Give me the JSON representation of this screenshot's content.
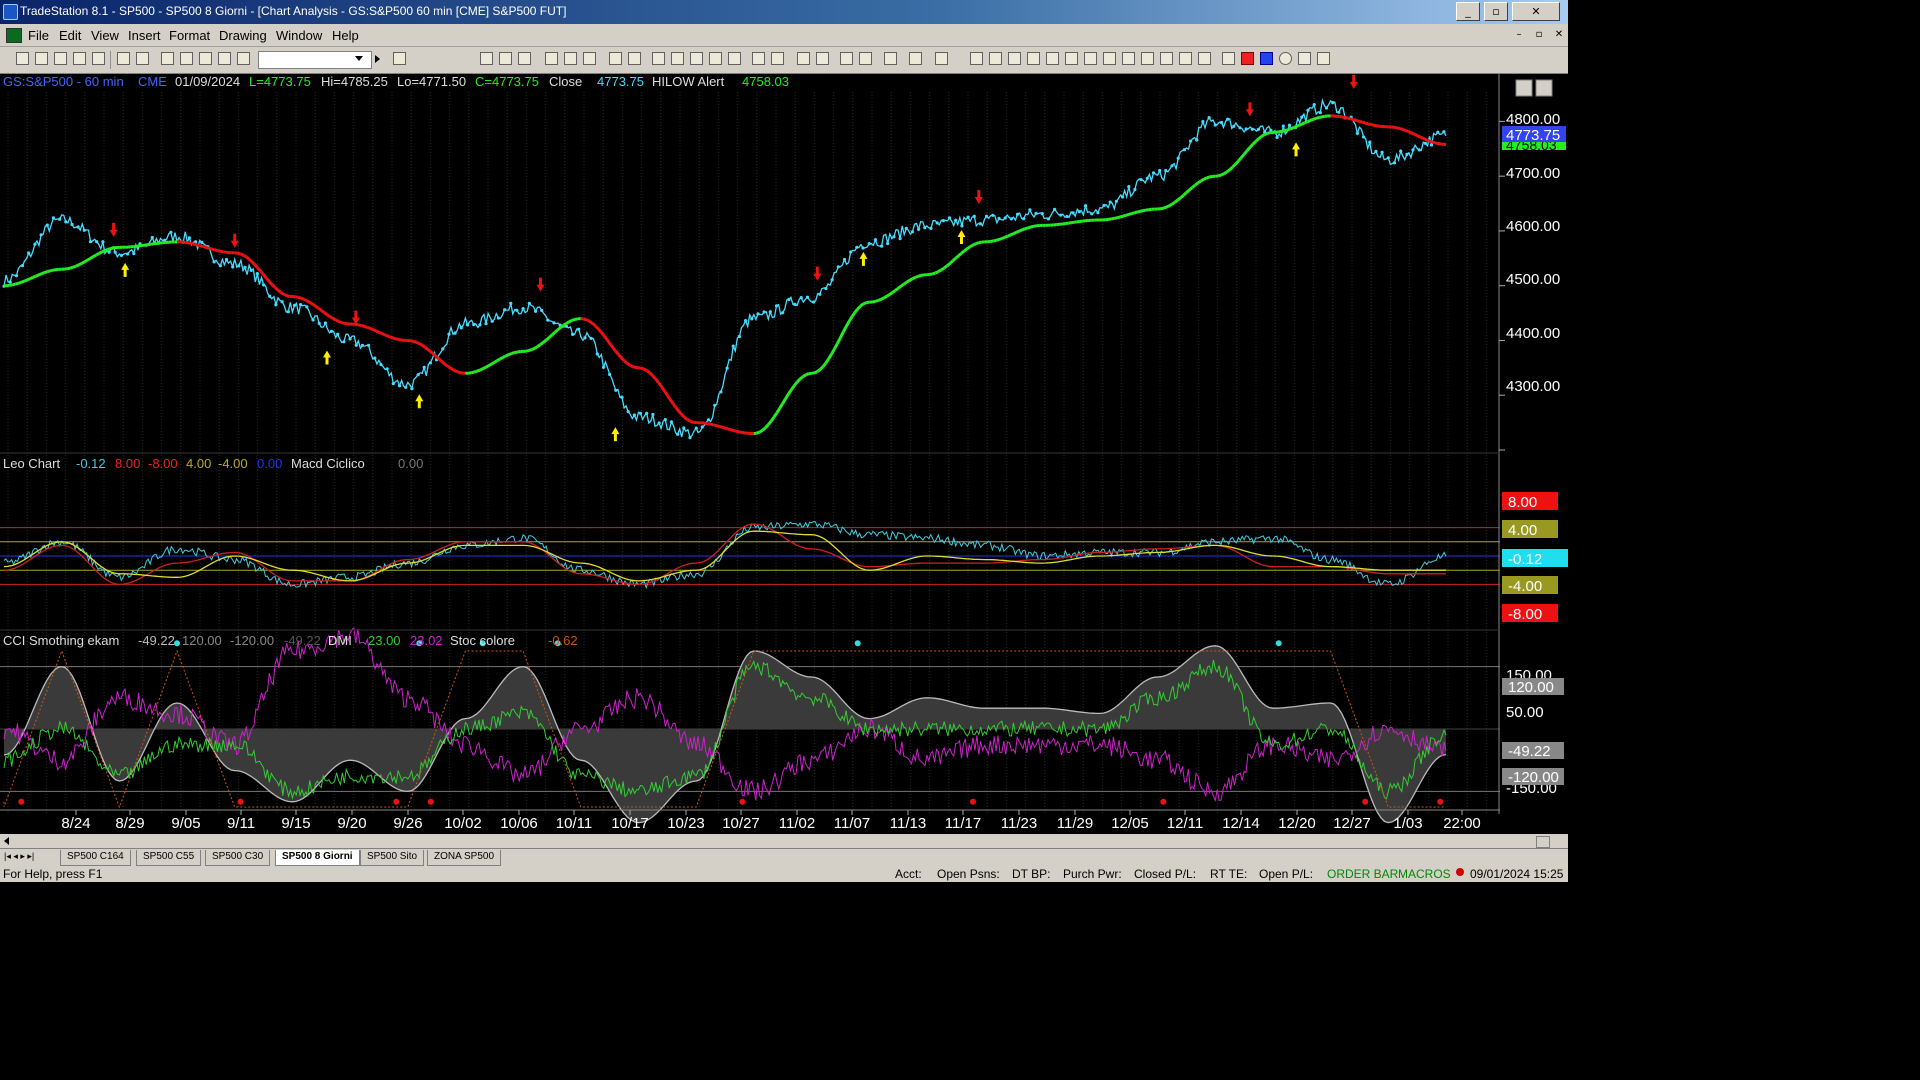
{
  "window": {
    "title": "TradeStation 8.1 - SP500 - SP500 8 Giorni - [Chart Analysis - GS:S&P500  60 min  [CME] S&P500 FUT]",
    "minimize": "_",
    "restore": "▫",
    "close": "✕"
  },
  "menu": {
    "items": [
      "File",
      "Edit",
      "View",
      "Insert",
      "Format",
      "Drawing",
      "Window",
      "Help"
    ],
    "mdi_buttons": [
      "–",
      "▫",
      "✕"
    ]
  },
  "toolbar": {
    "symbol_value": "",
    "icons": [
      "new-icon",
      "open-icon",
      "save-icon",
      "print-icon",
      "cut-icon",
      "copy-icon",
      "paste-icon",
      "zoom-in-icon",
      "zoom-out-icon",
      "cursor-icon",
      "trendline-icon",
      "text-icon"
    ]
  },
  "chart": {
    "header": {
      "symbol": "GS:S&P500 - 60 min",
      "exchange": "CME",
      "date": "01/09/2024",
      "last": "L=4773.75",
      "high": "Hi=4785.25",
      "low": "Lo=4771.50",
      "close_c": "C=4773.75",
      "close_label": "Close",
      "close_value": "4773.75",
      "indicator_name": "HILOW Alert",
      "indicator_value": "4758.03"
    },
    "price_axis": [
      "4800.00",
      "4700.00",
      "4600.00",
      "4500.00",
      "4400.00",
      "4300.00"
    ],
    "price_tag_last": "4773.75",
    "price_tag_green": "4758.03",
    "panel2": {
      "name": "Leo Chart",
      "values": [
        "-0.12",
        "8.00",
        "-8.00",
        "4.00",
        "-4.00",
        "0.00"
      ],
      "name2": "Macd Ciclico",
      "value2": "0.00",
      "axis_tags": [
        "8.00",
        "4.00",
        "-0.12",
        "-4.00",
        "-8.00"
      ]
    },
    "panel3": {
      "name": "CCI Smothing ekam",
      "values": [
        "-49.22",
        "120.00",
        "-120.00",
        "-49.22"
      ],
      "dmi_label": "DMI",
      "dmi_values": [
        "23.00",
        "23.02"
      ],
      "stoc_label": "Stoc colore",
      "stoc_value": "-0.62",
      "axis_labels": [
        "150.00",
        "50.00",
        "-150.00"
      ],
      "axis_tags": [
        "120.00",
        "-49.22",
        "-120.00"
      ]
    },
    "date_axis": [
      "8/24",
      "8/29",
      "9/05",
      "9/11",
      "9/15",
      "9/20",
      "9/26",
      "10/02",
      "10/06",
      "10/11",
      "10/17",
      "10/23",
      "10/27",
      "11/02",
      "11/07",
      "11/13",
      "11/17",
      "11/23",
      "11/29",
      "12/05",
      "12/11",
      "12/14",
      "12/20",
      "12/27",
      "1/03",
      "22:00"
    ],
    "colors": {
      "price": "#44ddff",
      "ma_up": "#22ee22",
      "ma_down": "#ee1111",
      "arrow_up": "#ffee00",
      "arrow_down": "#ee1111",
      "macd_blue": "#44ccdd",
      "macd_red": "#cc2222",
      "macd_yellow": "#dddd33",
      "cci_white": "#bbbbbb",
      "dmi_magenta": "#cc22cc",
      "dmi_green": "#33cc33",
      "stoc_orange": "#cc5511"
    }
  },
  "sheet_tabs": [
    "SP500 C164",
    "SP500 C55",
    "SP500 C30",
    "SP500 8 Giorni",
    "SP500 Sito",
    "ZONA SP500"
  ],
  "active_tab": "SP500 8 Giorni",
  "status": {
    "help": "For Help, press F1",
    "acct": "Acct:",
    "open_psns": "Open Psns:",
    "dt_bp": "DT BP:",
    "purch_pwr": "Purch Pwr:",
    "closed_pl": "Closed P/L:",
    "rt_te": "RT TE:",
    "open_pl": "Open P/L:",
    "order_bar": "ORDER BAR",
    "macros": "MACROS",
    "datetime": "09/01/2024 15:25"
  },
  "chart_data": [
    {
      "type": "line",
      "title": "GS:S&P500 - 60 min",
      "x": [
        "8/24",
        "8/29",
        "9/05",
        "9/11",
        "9/15",
        "9/20",
        "9/26",
        "10/02",
        "10/06",
        "10/11",
        "10/17",
        "10/23",
        "10/27",
        "11/02",
        "11/07",
        "11/13",
        "11/17",
        "11/23",
        "11/29",
        "12/05",
        "12/11",
        "12/14",
        "12/20",
        "12/27",
        "1/03",
        "22:00"
      ],
      "series": [
        {
          "name": "Close",
          "values": [
            4510,
            4620,
            4560,
            4590,
            4540,
            4460,
            4400,
            4320,
            4430,
            4460,
            4410,
            4260,
            4230,
            4440,
            4480,
            4580,
            4610,
            4620,
            4630,
            4640,
            4700,
            4800,
            4780,
            4830,
            4730,
            4773.75
          ]
        },
        {
          "name": "HILOW Alert",
          "values": [
            4500,
            4530,
            4570,
            4580,
            4560,
            4480,
            4430,
            4400,
            4340,
            4380,
            4440,
            4350,
            4250,
            4230,
            4340,
            4470,
            4520,
            4580,
            4610,
            4620,
            4640,
            4700,
            4780,
            4810,
            4790,
            4758.03
          ]
        }
      ],
      "ylim": [
        4200,
        4850
      ]
    },
    {
      "type": "line",
      "title": "Leo Chart",
      "x": [
        "8/24",
        "8/29",
        "9/05",
        "9/11",
        "9/15",
        "9/20",
        "9/26",
        "10/02",
        "10/06",
        "10/11",
        "10/17",
        "10/23",
        "10/27",
        "11/02",
        "11/07",
        "11/13",
        "11/17",
        "11/23",
        "11/29",
        "12/05",
        "12/11",
        "12/14",
        "12/20",
        "12/27",
        "1/03",
        "22:00"
      ],
      "series": [
        {
          "values": [
            -2,
            4,
            -6,
            2,
            -1,
            -8,
            -6,
            -2,
            3,
            5,
            -4,
            -8,
            -5,
            8,
            9,
            6,
            5,
            3,
            0,
            1,
            1,
            4,
            5,
            -1,
            -8,
            -0.12
          ]
        },
        {
          "values": [
            -4,
            3,
            -8,
            -2,
            1,
            -7,
            -7,
            -1,
            4,
            4,
            -5,
            -8,
            -2,
            9,
            2,
            -3,
            -2,
            -2,
            -1,
            1,
            2,
            3,
            -3,
            -3,
            -5,
            -5
          ]
        },
        {
          "values": [
            -3,
            4,
            -5,
            -6,
            0,
            -4,
            -7,
            -2,
            3,
            3,
            -2,
            -7,
            -4,
            7,
            6,
            -4,
            0,
            -1,
            -2,
            0,
            1,
            3,
            0,
            -3,
            -4,
            -4
          ]
        }
      ],
      "ylim": [
        -10,
        10
      ]
    },
    {
      "type": "line",
      "title": "CCI Smothing ekam",
      "x": [
        "8/24",
        "8/29",
        "9/05",
        "9/11",
        "9/15",
        "9/20",
        "9/26",
        "10/02",
        "10/06",
        "10/11",
        "10/17",
        "10/23",
        "10/27",
        "11/02",
        "11/07",
        "11/13",
        "11/17",
        "11/23",
        "11/29",
        "12/05",
        "12/11",
        "12/14",
        "12/20",
        "12/27",
        "1/03",
        "22:00"
      ],
      "series": [
        {
          "name": "CCI",
          "values": [
            -50,
            120,
            -100,
            50,
            -80,
            -140,
            -60,
            -120,
            20,
            120,
            -60,
            -180,
            -100,
            150,
            100,
            20,
            60,
            40,
            40,
            30,
            100,
            160,
            40,
            50,
            -180,
            -49.22
          ]
        },
        {
          "name": "DMI",
          "values": [
            30,
            20,
            40,
            35,
            25,
            55,
            60,
            40,
            25,
            15,
            30,
            40,
            25,
            10,
            20,
            30,
            20,
            25,
            25,
            25,
            20,
            10,
            25,
            20,
            30,
            23.02
          ]
        },
        {
          "name": "DMI+",
          "values": [
            15,
            25,
            10,
            20,
            20,
            5,
            10,
            10,
            25,
            30,
            10,
            5,
            10,
            45,
            35,
            25,
            25,
            25,
            25,
            25,
            35,
            45,
            20,
            25,
            5,
            23.0
          ]
        }
      ],
      "ylim": [
        -200,
        200
      ]
    }
  ]
}
